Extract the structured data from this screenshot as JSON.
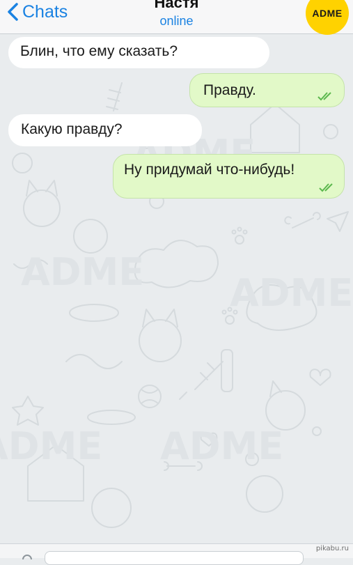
{
  "header": {
    "back_label": "Chats",
    "contact_name": "Настя",
    "status": "online",
    "badge": "ADME"
  },
  "messages": [
    {
      "direction": "incoming",
      "text": "Блин, что ему сказать?"
    },
    {
      "direction": "outgoing",
      "text": "Правду.",
      "read": true
    },
    {
      "direction": "incoming",
      "text": "Какую правду?"
    },
    {
      "direction": "outgoing",
      "text": "Ну придумай что-нибудь!",
      "read": true
    }
  ],
  "background_watermark": "ADME",
  "composer": {
    "placeholder": ""
  },
  "footer_watermark": "pikabu.ru",
  "colors": {
    "accent": "#1a82e2",
    "chat_background": "#e9ecee",
    "incoming_bubble": "#ffffff",
    "outgoing_bubble": "#e2f9c8",
    "check_marks": "#5cb84e",
    "badge": "#ffd200"
  }
}
